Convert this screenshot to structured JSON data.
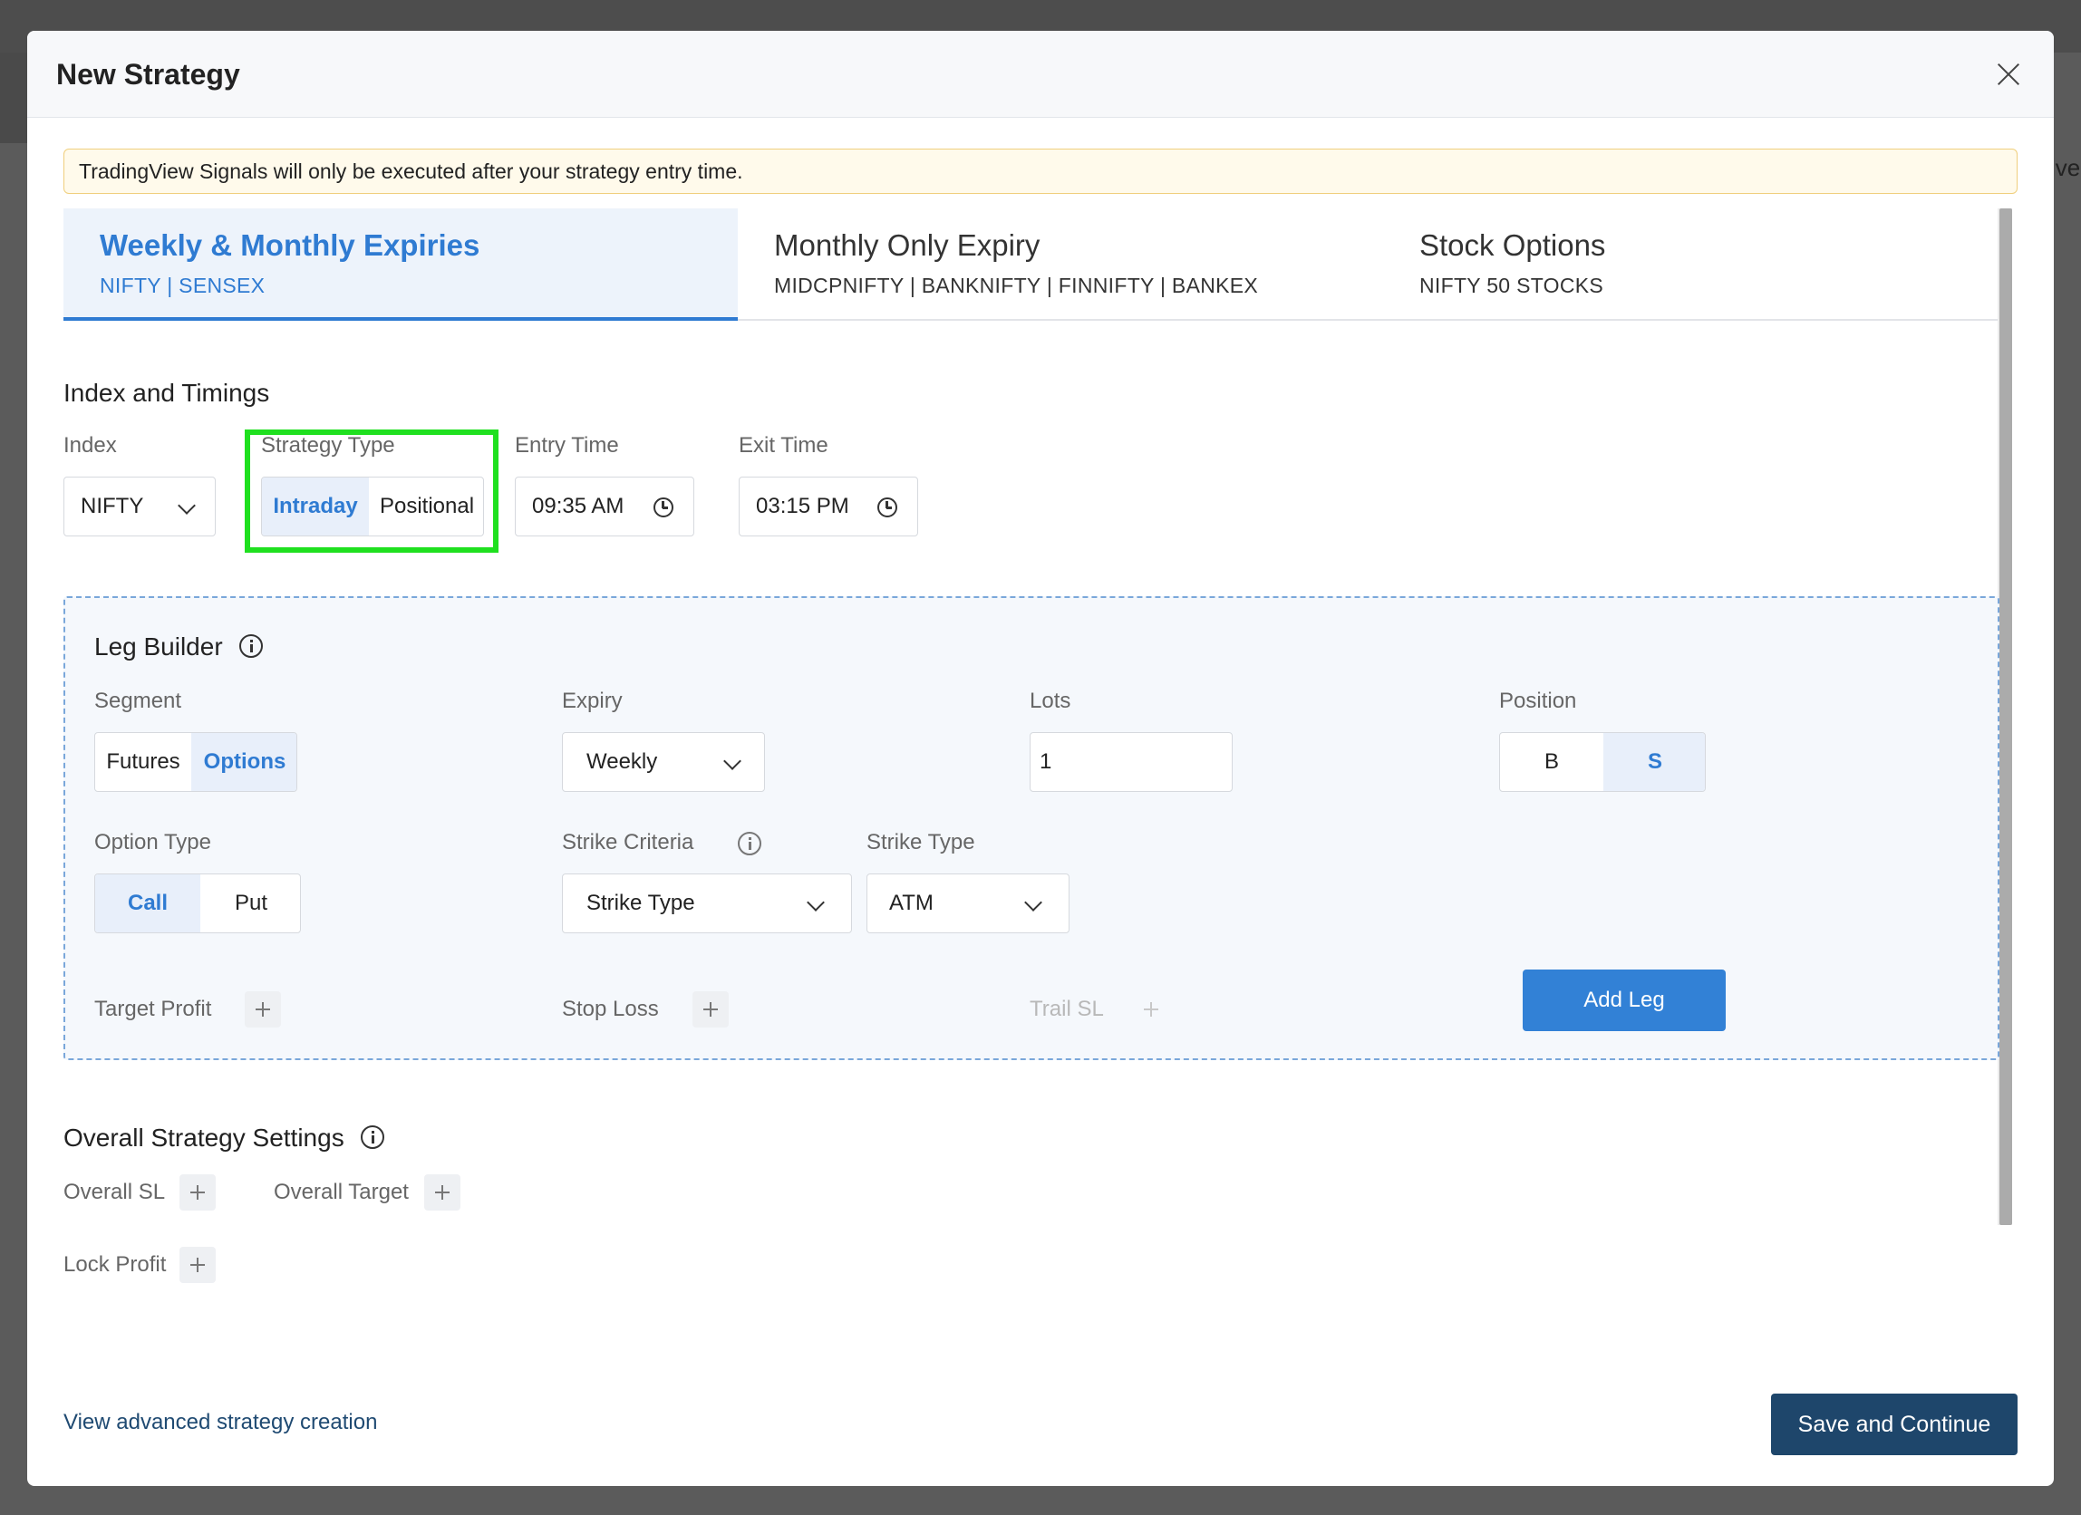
{
  "background": {
    "right_text": "ive"
  },
  "modal": {
    "title": "New Strategy",
    "notice": "TradingView Signals will only be executed after your strategy entry time."
  },
  "tabs": [
    {
      "title": "Weekly & Monthly Expiries",
      "subtitle": "NIFTY | SENSEX",
      "active": true
    },
    {
      "title": "Monthly Only Expiry",
      "subtitle": "MIDCPNIFTY | BANKNIFTY | FINNIFTY | BANKEX",
      "active": false
    },
    {
      "title": "Stock Options",
      "subtitle": "NIFTY 50 STOCKS",
      "active": false
    }
  ],
  "index_timings": {
    "title": "Index and Timings",
    "index_label": "Index",
    "index_value": "NIFTY",
    "strategy_type_label": "Strategy Type",
    "strategy_type_options": [
      "Intraday",
      "Positional"
    ],
    "strategy_type_selected": "Intraday",
    "entry_time_label": "Entry Time",
    "entry_time_value": "09:35 AM",
    "exit_time_label": "Exit Time",
    "exit_time_value": "03:15 PM"
  },
  "leg_builder": {
    "title": "Leg Builder",
    "segment_label": "Segment",
    "segment_options": [
      "Futures",
      "Options"
    ],
    "segment_selected": "Options",
    "expiry_label": "Expiry",
    "expiry_value": "Weekly",
    "lots_label": "Lots",
    "lots_value": "1",
    "position_label": "Position",
    "position_options": [
      "B",
      "S"
    ],
    "position_selected": "S",
    "option_type_label": "Option Type",
    "option_type_options": [
      "Call",
      "Put"
    ],
    "option_type_selected": "Call",
    "strike_criteria_label": "Strike Criteria",
    "strike_criteria_value": "Strike Type",
    "strike_type_label": "Strike Type",
    "strike_type_value": "ATM",
    "target_profit_label": "Target Profit",
    "stop_loss_label": "Stop Loss",
    "trail_sl_label": "Trail SL",
    "add_leg_label": "Add Leg"
  },
  "overall": {
    "title": "Overall Strategy Settings",
    "overall_sl_label": "Overall SL",
    "overall_target_label": "Overall Target",
    "lock_profit_label": "Lock Profit"
  },
  "footer": {
    "advanced_link": "View advanced strategy creation",
    "save_label": "Save and Continue"
  },
  "colors": {
    "accent": "#2f7bd2",
    "primary_button": "#3281d6",
    "save_button": "#1e466b",
    "highlight_box": "#1fe01f",
    "notice_bg": "#fffaeb"
  }
}
